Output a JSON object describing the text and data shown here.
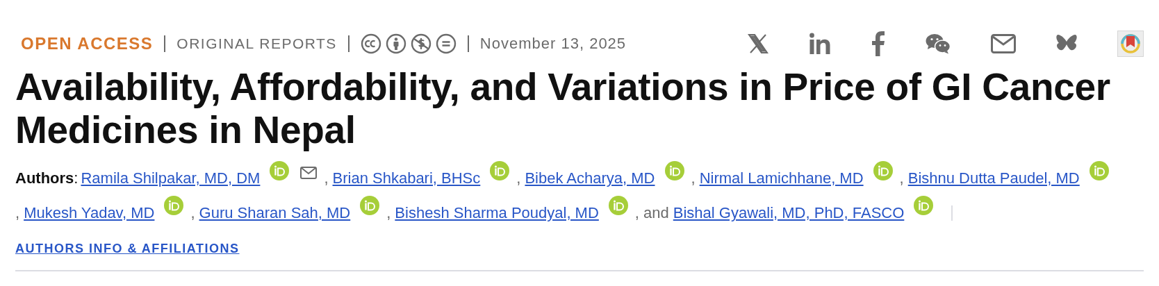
{
  "header": {
    "access": "OPEN ACCESS",
    "section": "ORIGINAL REPORTS",
    "licenses": [
      {
        "kind": "cc"
      },
      {
        "kind": "by"
      },
      {
        "kind": "nc"
      },
      {
        "kind": "nd"
      }
    ],
    "date": "November 13, 2025"
  },
  "share": [
    {
      "kind": "x"
    },
    {
      "kind": "linkedin"
    },
    {
      "kind": "facebook"
    },
    {
      "kind": "wechat"
    },
    {
      "kind": "email"
    },
    {
      "kind": "bluesky"
    },
    {
      "kind": "bookmark-app"
    }
  ],
  "title": "Availability, Affordability, and Variations in Price of GI Cancer Medicines in Nepal",
  "authors_label": "**Authors**:",
  "authors": [
    {
      "name": "Ramila Shilpakar, MD, DM",
      "email": true
    },
    {
      "separator": ",",
      "name": "Brian Shkabari, BHSc",
      "email": false
    },
    {
      "separator": ",",
      "name": "Bibek Acharya, MD",
      "email": false
    },
    {
      "separator": ",",
      "name": "Nirmal Lamichhane, MD",
      "email": false
    },
    {
      "separator": ",",
      "name": "Bishnu Dutta Paudel, MD",
      "email": false
    },
    {
      "separator": ",",
      "name": "Mukesh Yadav, MD",
      "email": false
    },
    {
      "separator": ",",
      "name": "Guru Sharan Sah, MD",
      "email": false
    },
    {
      "separator": ",",
      "name": "Bishesh Sharma Poudyal, MD",
      "email": false
    },
    {
      "separator": ", and",
      "name": "Bishal Gyawali, MD, PhD, FASCO",
      "email": false
    }
  ],
  "info_link": "AUTHORS INFO & AFFILIATIONS"
}
